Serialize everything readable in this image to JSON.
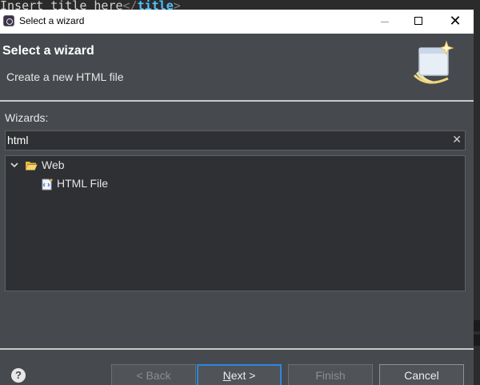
{
  "background_editor": {
    "text": "Insert title here",
    "tag_open": "</",
    "tag_name": "title",
    "tag_close": ">"
  },
  "dialog": {
    "window_title": "Select a wizard",
    "heading": "Select a wizard",
    "subtitle": "Create a new HTML file",
    "wizards_label": "Wizards:",
    "filter_value": "html",
    "filter_clear": "✕",
    "tree": [
      {
        "label": "Web",
        "expanded": true,
        "icon": "folder-open-icon",
        "children": [
          {
            "label": "HTML File",
            "icon": "html-file-icon"
          }
        ]
      }
    ],
    "buttons": {
      "help": "?",
      "back": "< Back",
      "next_mnemonic": "N",
      "next_rest": "ext >",
      "finish": "Finish",
      "cancel": "Cancel"
    }
  },
  "colors": {
    "dialog_bg": "#464a4e",
    "tree_bg": "#2f3033",
    "default_button_border": "#2e86de"
  }
}
